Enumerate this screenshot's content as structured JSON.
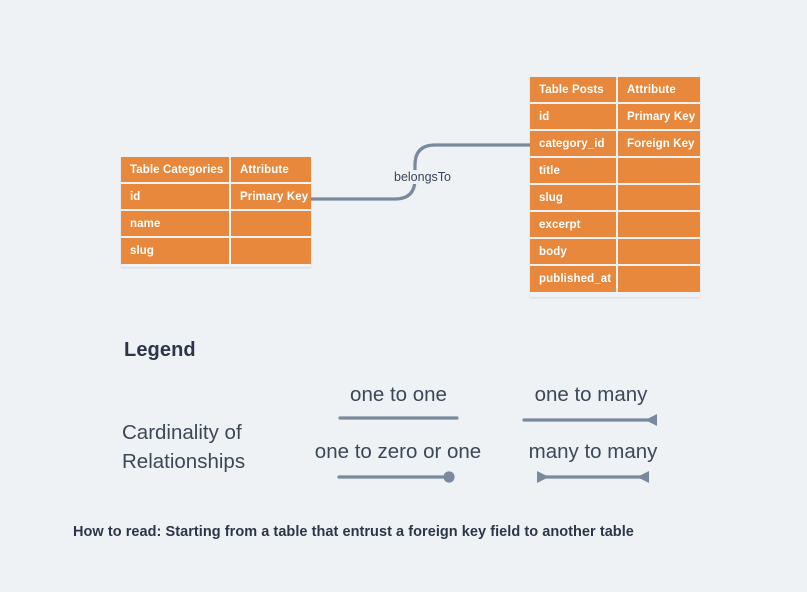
{
  "colors": {
    "background": "#eff2f5",
    "table_fill": "#e8883c",
    "table_text": "#ffffff",
    "line": "#7a8a9e",
    "heading_text": "#2b3648",
    "body_text": "#3b4858"
  },
  "diagram": {
    "tables": [
      {
        "id": "categories",
        "name_header": "Table Categories",
        "attribute_header": "Attribute",
        "rows": [
          {
            "field": "id",
            "attribute": "Primary Key"
          },
          {
            "field": "name",
            "attribute": ""
          },
          {
            "field": "slug",
            "attribute": ""
          }
        ]
      },
      {
        "id": "posts",
        "name_header": "Table Posts",
        "attribute_header": "Attribute",
        "rows": [
          {
            "field": "id",
            "attribute": "Primary Key"
          },
          {
            "field": "category_id",
            "attribute": "Foreign Key"
          },
          {
            "field": "title",
            "attribute": ""
          },
          {
            "field": "slug",
            "attribute": ""
          },
          {
            "field": "excerpt",
            "attribute": ""
          },
          {
            "field": "body",
            "attribute": ""
          },
          {
            "field": "published_at",
            "attribute": ""
          }
        ]
      }
    ],
    "relationship": {
      "label": "belongsTo",
      "from": "categories.id",
      "to": "posts.category_id"
    }
  },
  "legend": {
    "title": "Legend",
    "group_label": "Cardinality of\nRelationships",
    "group_label_line1": "Cardinality of",
    "group_label_line2": "Relationships",
    "items": [
      {
        "label": "one to one",
        "symbol": "plain-line"
      },
      {
        "label": "one to many",
        "symbol": "line-with-arrow-right"
      },
      {
        "label": "one to zero or one",
        "symbol": "line-with-circle-right"
      },
      {
        "label": "many to many",
        "symbol": "line-with-arrows-both"
      }
    ]
  },
  "caption": {
    "text": "How to read: Starting from a table that entrust a foreign key field to another table"
  }
}
